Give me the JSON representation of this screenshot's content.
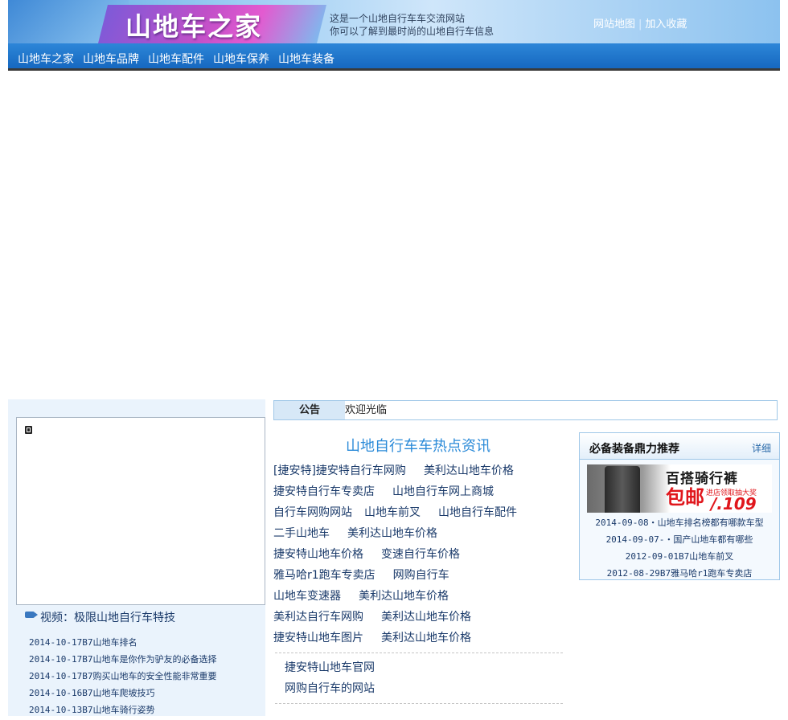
{
  "header": {
    "logo": "山地车之家",
    "tagline_line1": "这是一个山地自行车车交流网站",
    "tagline_line2": "你可以了解到最时尚的山地自行车信息",
    "link_sitemap": "网站地图",
    "link_separator": "|",
    "link_favorite": "加入收藏"
  },
  "nav": {
    "items": [
      "山地车之家",
      "山地车品牌",
      "山地车配件",
      "山地车保养",
      "山地车装备"
    ]
  },
  "notice": {
    "label": "公告",
    "text": "欢迎光临"
  },
  "left": {
    "video_caption": "视频：极限山地自行车特技",
    "news": [
      "2014-10-17B7山地车排名",
      "2014-10-17B7山地车是你作为驴友的必备选择",
      "2014-10-17B7购买山地车的安全性能非常重要",
      "2014-10-16B7山地车爬坡技巧",
      "2014-10-13B7山地车骑行姿势"
    ]
  },
  "center": {
    "title": "山地自行车车热点资讯",
    "rows": [
      [
        "[捷安特]捷安特自行车网购",
        "美利达山地车价格"
      ],
      [
        "捷安特自行车专卖店",
        "山地自行车网上商城"
      ],
      [
        "自行车网购网站",
        "山地车前叉",
        "山地自行车配件"
      ],
      [
        "二手山地车",
        "美利达山地车价格"
      ],
      [
        "捷安特山地车价格",
        "变速自行车价格"
      ],
      [
        "雅马哈r1跑车专卖店",
        "网购自行车"
      ],
      [
        "山地车变速器",
        "美利达山地车价格"
      ],
      [
        "美利达自行车网购",
        "美利达山地车价格"
      ],
      [
        "捷安特山地车图片",
        "美利达山地车价格"
      ]
    ],
    "bottom_links": [
      "捷安特山地车官网",
      "网购自行车的网站"
    ]
  },
  "right": {
    "title": "必备装备鼎力推荐",
    "more": "详细",
    "banner": {
      "line1": "百搭骑行裤",
      "line2": "包邮",
      "line3": "进店领取抽大奖",
      "price": "/.109元"
    },
    "items": [
      "2014-09-08・山地车排名榜都有哪款车型",
      "2014-09-07-・国产山地车都有哪些",
      "2012-09-01B7山地车前叉",
      "2012-08-29B7雅马哈r1跑车专卖店"
    ]
  },
  "colors": {
    "nav_bg": "#1668c0",
    "accent_blue": "#2a8ad8",
    "price_red": "#e0161c"
  }
}
